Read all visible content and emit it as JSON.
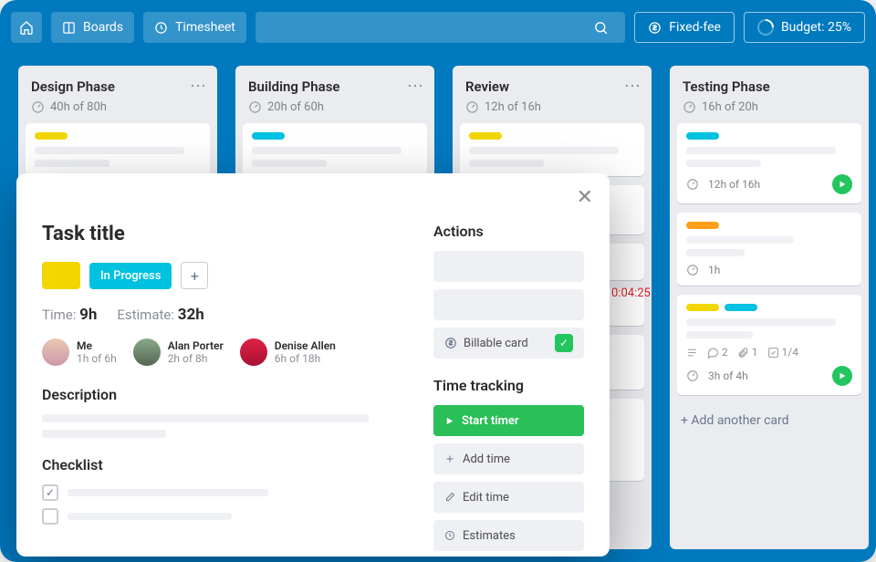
{
  "topbar": {
    "boards_label": "Boards",
    "timesheet_label": "Timesheet",
    "fixed_fee_label": "Fixed-fee",
    "budget_label": "Budget: 25%"
  },
  "columns": [
    {
      "title": "Design Phase",
      "time": "40h of 80h",
      "cards": [
        {
          "labels": [
            "yellow"
          ]
        }
      ]
    },
    {
      "title": "Building Phase",
      "time": "20h of 60h",
      "cards": [
        {
          "labels": [
            "cyan"
          ]
        }
      ]
    },
    {
      "title": "Review",
      "time": "12h of 16h",
      "cards": [
        {
          "labels": [
            "yellow"
          ],
          "running_time": "0:04:25"
        }
      ]
    },
    {
      "title": "Testing Phase",
      "time": "16h of 20h",
      "cards": [
        {
          "labels": [
            "cyan"
          ],
          "time": "12h of 16h",
          "has_play": true
        },
        {
          "labels": [
            "orange"
          ],
          "time": "1h"
        },
        {
          "labels": [
            "yellow",
            "cyan"
          ],
          "time": "3h of 4h",
          "has_play": true,
          "badges": {
            "comments": 2,
            "attachments": 1,
            "checklist": "1/4"
          }
        }
      ],
      "add_label": "+ Add another card"
    }
  ],
  "modal": {
    "title": "Task title",
    "status": "In Progress",
    "time_label": "Time:",
    "time_value": "9h",
    "estimate_label": "Estimate:",
    "estimate_value": "32h",
    "members": [
      {
        "name": "Me",
        "time": "1h of 6h"
      },
      {
        "name": "Alan Porter",
        "time": "2h of 8h"
      },
      {
        "name": "Denise Allen",
        "time": "6h of 18h"
      }
    ],
    "description_title": "Description",
    "checklist_title": "Checklist",
    "actions_title": "Actions",
    "billable_label": "Billable card",
    "timetracking_title": "Time tracking",
    "start_timer": "Start timer",
    "add_time": "Add time",
    "edit_time": "Edit time",
    "estimates": "Estimates"
  }
}
